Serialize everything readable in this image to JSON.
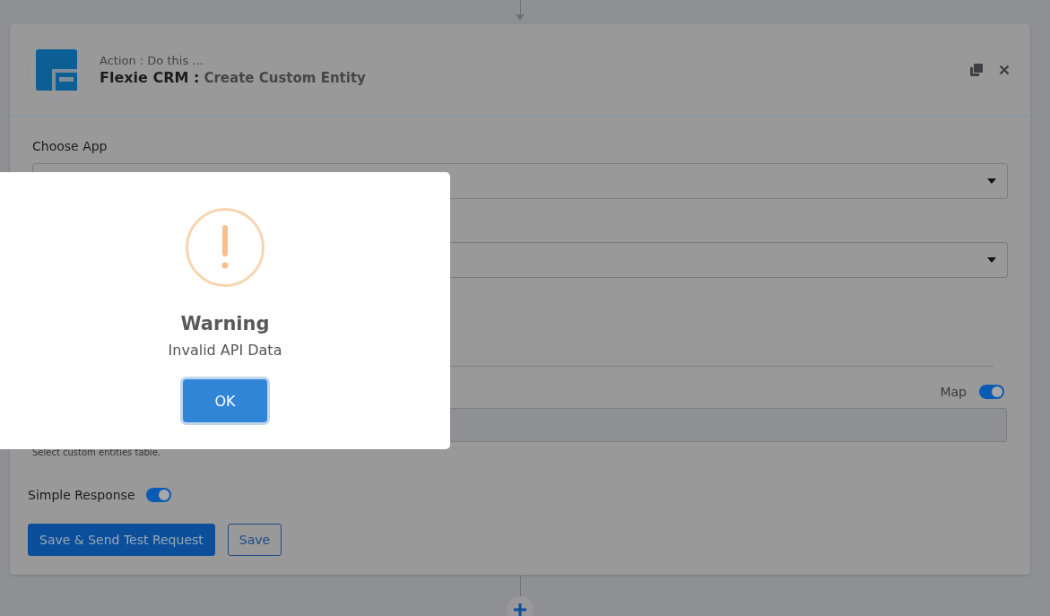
{
  "step_card": {
    "subtitle": "Action : Do this ...",
    "app_name": "Flexie CRM :",
    "action_name": "Create Custom Entity"
  },
  "fields": [
    {
      "kind": "select",
      "label": "Choose App"
    },
    {
      "kind": "select"
    },
    {
      "kind": "divider"
    },
    {
      "kind": "mapped",
      "map_label": "Map",
      "map_on": true,
      "help": "Select custom entities table."
    }
  ],
  "simple_response": {
    "label": "Simple Response",
    "on": true
  },
  "buttons": [
    {
      "kind": "primary",
      "label": "Save & Send Test Request"
    },
    {
      "kind": "outline",
      "label": "Save"
    }
  ],
  "dialog": {
    "title": "Warning",
    "message": "Invalid API Data",
    "button": "OK"
  }
}
